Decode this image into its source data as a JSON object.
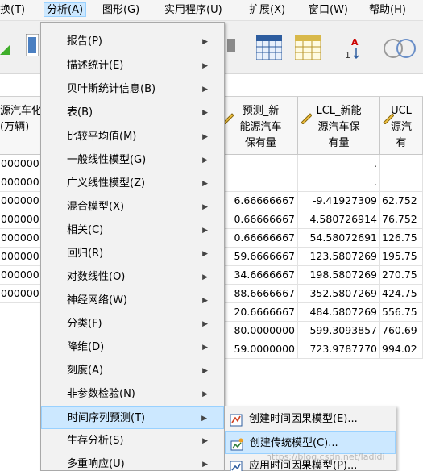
{
  "menubar": {
    "items": [
      "换(T)",
      "分析(A)",
      "图形(G)",
      "实用程序(U)",
      "扩展(X)",
      "窗口(W)",
      "帮助(H)"
    ]
  },
  "grid": {
    "headers": [
      "源汽车化\n(万辆)",
      "预测_新\n能源汽车\n保有量",
      "LCL_新能\n源汽车保\n有量",
      "UCL\n源汽\n有"
    ],
    "left_col": [
      "000000",
      "000000",
      "000000",
      "000000",
      "000000",
      "000000",
      "000000",
      "000000"
    ],
    "col_pred": [
      "",
      "",
      "6.66666667",
      "0.66666667",
      "0.66666667",
      "59.6666667",
      "34.6666667",
      "88.6666667",
      "20.6666667",
      "80.0000000",
      "59.0000000"
    ],
    "col_lcl": [
      ".",
      ".",
      "-9.41927309",
      "4.580726914",
      "54.58072691",
      "123.5807269",
      "198.5807269",
      "352.5807269",
      "484.5807269",
      "599.3093857",
      "723.9787770"
    ],
    "col_ucl": [
      "",
      "",
      "62.752",
      "76.752",
      "126.75",
      "195.75",
      "270.75",
      "424.75",
      "556.75",
      "760.69",
      "994.02"
    ]
  },
  "dropdown": {
    "items": [
      {
        "label": "报告(P)",
        "arrow": true
      },
      {
        "label": "描述统计(E)",
        "arrow": true
      },
      {
        "label": "贝叶斯统计信息(B)",
        "arrow": true
      },
      {
        "label": "表(B)",
        "arrow": true
      },
      {
        "label": "比较平均值(M)",
        "arrow": true
      },
      {
        "label": "一般线性模型(G)",
        "arrow": true
      },
      {
        "label": "广义线性模型(Z)",
        "arrow": true
      },
      {
        "label": "混合模型(X)",
        "arrow": true
      },
      {
        "label": "相关(C)",
        "arrow": true
      },
      {
        "label": "回归(R)",
        "arrow": true
      },
      {
        "label": "对数线性(O)",
        "arrow": true
      },
      {
        "label": "神经网络(W)",
        "arrow": true
      },
      {
        "label": "分类(F)",
        "arrow": true
      },
      {
        "label": "降维(D)",
        "arrow": true
      },
      {
        "label": "刻度(A)",
        "arrow": true
      },
      {
        "label": "非参数检验(N)",
        "arrow": true
      },
      {
        "label": "时间序列预测(T)",
        "arrow": true
      },
      {
        "label": "生存分析(S)",
        "arrow": true
      },
      {
        "label": "多重响应(U)",
        "arrow": true
      }
    ]
  },
  "submenu": {
    "items": [
      {
        "label": "创建时间因果模型(E)...",
        "icon": "causal-model-icon"
      },
      {
        "label": "创建传统模型(C)...",
        "icon": "traditional-model-icon"
      },
      {
        "label": "应用时间因果模型(P)...",
        "icon": "apply-model-icon"
      }
    ]
  },
  "watermark": "https://blog.csdn.net/ladidi"
}
